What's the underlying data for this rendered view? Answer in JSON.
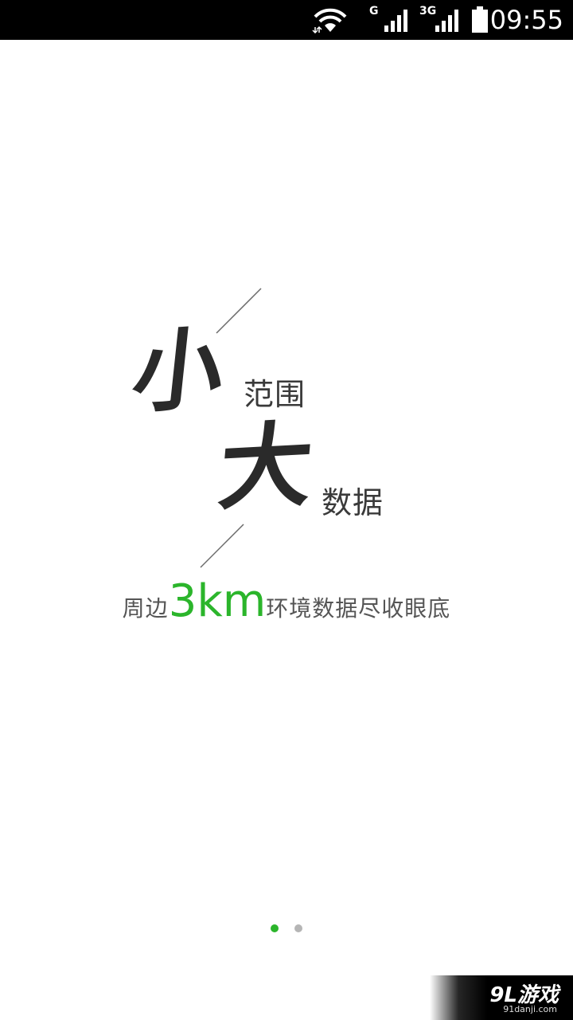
{
  "status_bar": {
    "network_1": "G",
    "network_2": "3G",
    "time": "09:55",
    "icons": [
      "wifi-icon",
      "signal-icon",
      "signal-icon",
      "battery-icon"
    ]
  },
  "splash": {
    "char_small": "小",
    "text_range": "范围",
    "char_big": "大",
    "text_data": "数据",
    "tagline_prefix": "周边",
    "tagline_highlight": "3km",
    "tagline_suffix": "环境数据尽收眼底"
  },
  "pager": {
    "page_count": 2,
    "active_index": 0
  },
  "watermark": {
    "main": "9L游戏",
    "sub": "91danji.com"
  },
  "colors": {
    "accent_green": "#2bb52b",
    "text_dark": "#2a2a2a",
    "inactive_dot": "#b5b5b5"
  }
}
